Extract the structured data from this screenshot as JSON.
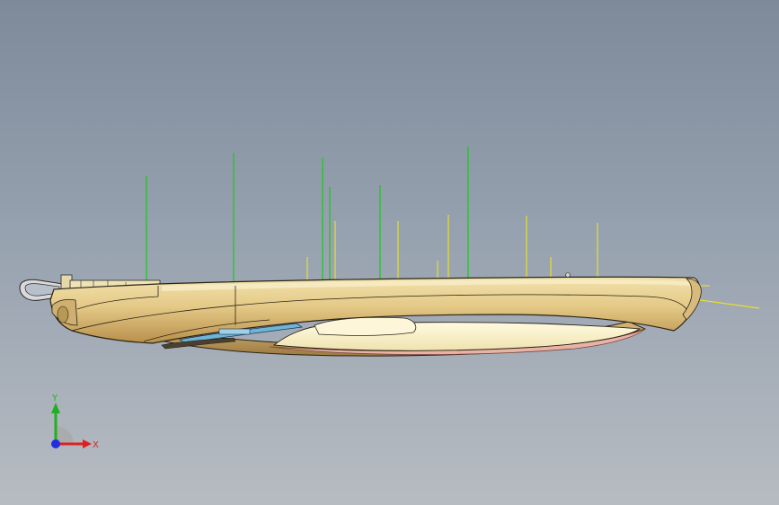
{
  "triad": {
    "y_label": "Y",
    "x_label": "X",
    "colors": {
      "x": "#e02020",
      "y": "#20b020",
      "z": "#2030e0"
    }
  },
  "model": {
    "body_color": "#e8d49a",
    "body_shade": "#c9a55f",
    "edge_color": "#2a2416",
    "lens_color": "#f7f0c8",
    "sketch_line_green": "#19c819",
    "sketch_line_yellow": "#e6e02a"
  }
}
